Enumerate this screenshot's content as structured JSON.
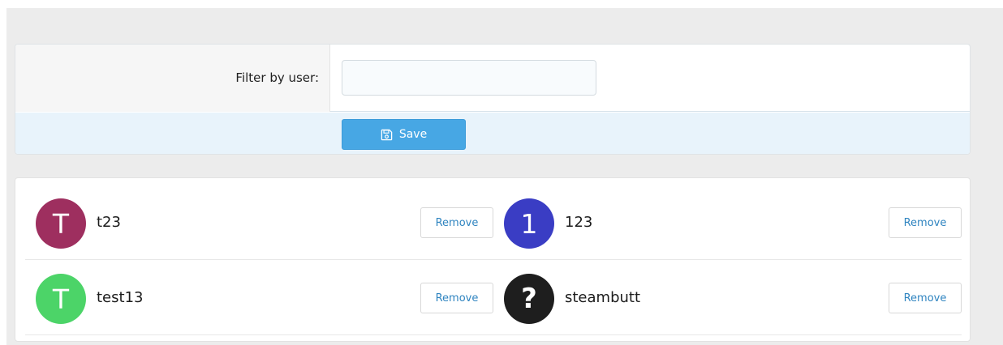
{
  "filter": {
    "label": "Filter by user:",
    "value": "",
    "placeholder": ""
  },
  "actions": {
    "save_label": "Save"
  },
  "colors": {
    "save_button": "#47a7e4",
    "link": "#2f84c0"
  },
  "users": [
    {
      "name": "t23",
      "avatar_letter": "T",
      "avatar_color": "#9e2f5f"
    },
    {
      "name": "123",
      "avatar_letter": "1",
      "avatar_color": "#3a3dc4"
    },
    {
      "name": "test13",
      "avatar_letter": "T",
      "avatar_color": "#4cd468"
    },
    {
      "name": "steambutt",
      "avatar_letter": "?",
      "avatar_color": "#1e1e1e"
    }
  ],
  "remove_label": "Remove"
}
